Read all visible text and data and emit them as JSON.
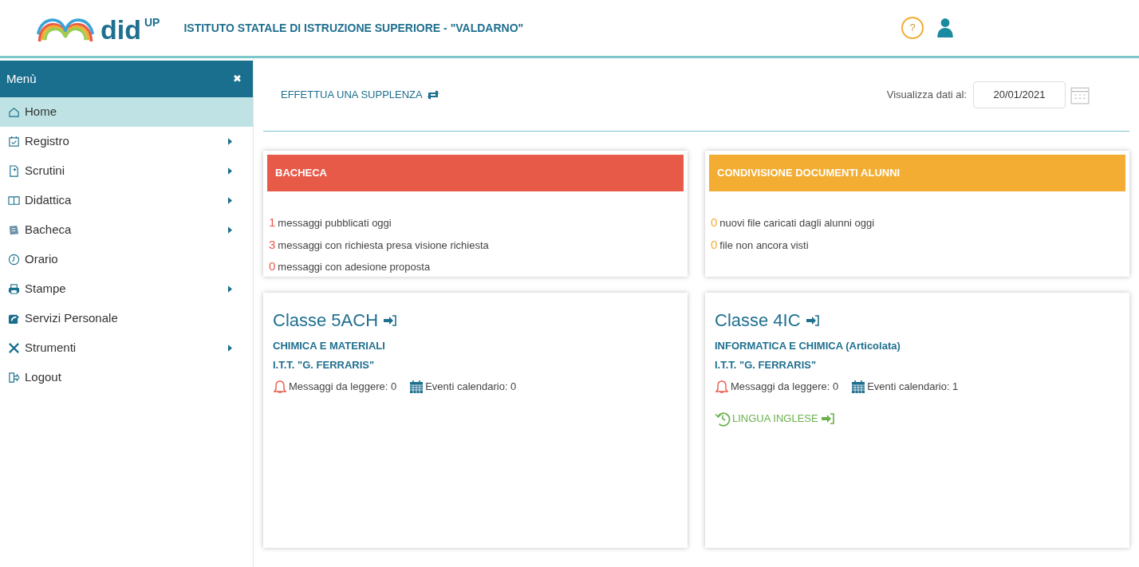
{
  "header": {
    "logo_text": "did",
    "logo_sup": "UP",
    "school": "ISTITUTO STATALE DI ISTRUZIONE SUPERIORE - \"VALDARNO\"",
    "help": "?"
  },
  "sidebar": {
    "title": "Menù",
    "close": "✖",
    "items": [
      {
        "label": "Home",
        "selected": true,
        "submenu": false
      },
      {
        "label": "Registro",
        "selected": false,
        "submenu": true
      },
      {
        "label": "Scrutini",
        "selected": false,
        "submenu": true
      },
      {
        "label": "Didattica",
        "selected": false,
        "submenu": true
      },
      {
        "label": "Bacheca",
        "selected": false,
        "submenu": true
      },
      {
        "label": "Orario",
        "selected": false,
        "submenu": false
      },
      {
        "label": "Stampe",
        "selected": false,
        "submenu": true
      },
      {
        "label": "Servizi Personale",
        "selected": false,
        "submenu": false
      },
      {
        "label": "Strumenti",
        "selected": false,
        "submenu": true
      },
      {
        "label": "Logout",
        "selected": false,
        "submenu": false
      }
    ]
  },
  "toolbar": {
    "substitution": "EFFETTUA UNA SUPPLENZA",
    "date_label": "Visualizza dati al:",
    "date": "20/01/2021"
  },
  "panels": [
    {
      "title": "BACHECA",
      "color": "#e85a48",
      "lines": [
        {
          "count": "1",
          "text": "messaggi pubblicati oggi"
        },
        {
          "count": "3",
          "text": "messaggi con richiesta presa visione richiesta"
        },
        {
          "count": "0",
          "text": "messaggi con adesione proposta"
        }
      ]
    },
    {
      "title": "CONDIVISIONE DOCUMENTI ALUNNI",
      "color": "#f3ad33",
      "lines": [
        {
          "count": "0",
          "text": "nuovi file caricati dagli alunni oggi"
        },
        {
          "count": "0",
          "text": "file non ancora visti"
        }
      ]
    }
  ],
  "classes": [
    {
      "title": "Classe 5ACH",
      "subject": "CHIMICA E MATERIALI",
      "school": "I.T.T. \"G. FERRARIS\"",
      "messages": "Messaggi da leggere: 0",
      "events": "Eventi calendario: 0"
    },
    {
      "title": "Classe 4IC",
      "subject": "INFORMATICA E CHIMICA (Articolata)",
      "school": "I.T.T. \"G. FERRARIS\"",
      "messages": "Messaggi da leggere: 0",
      "events": "Eventi calendario: 1",
      "lessons": [
        "LINGUA INGLESE"
      ]
    }
  ]
}
